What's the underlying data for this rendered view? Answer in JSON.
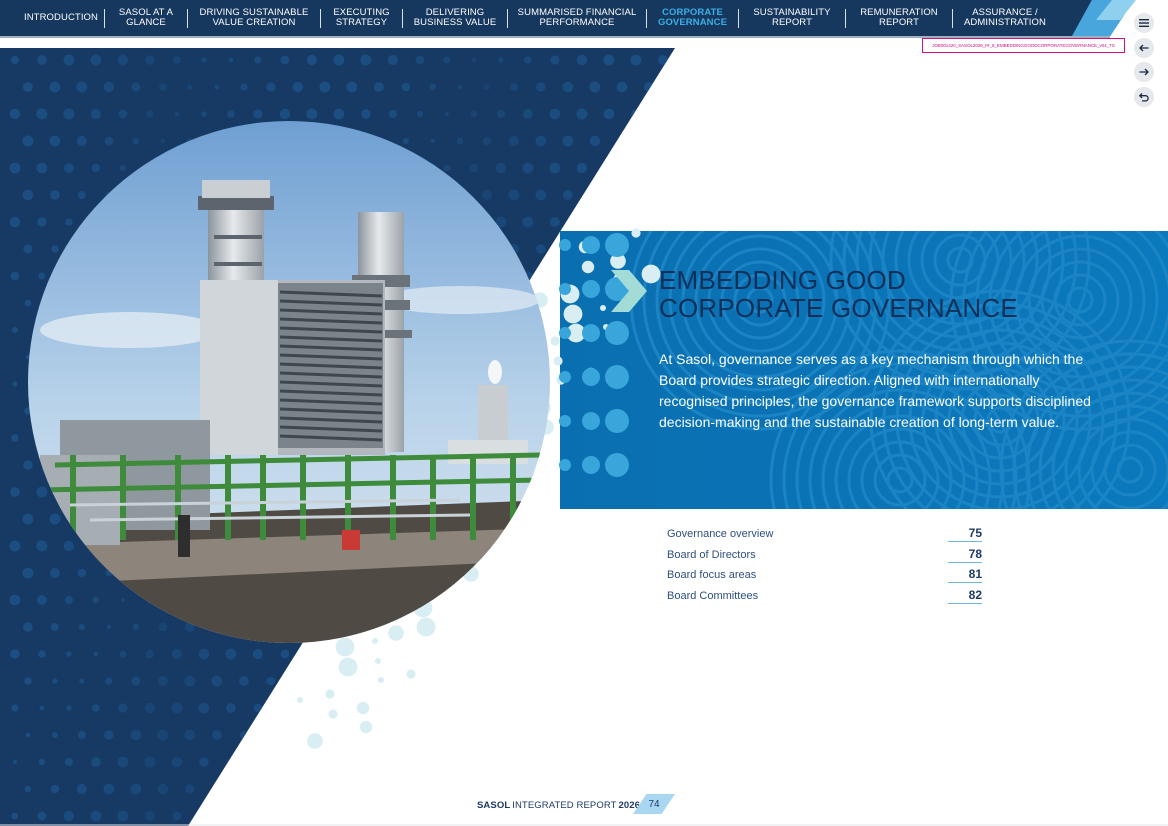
{
  "nav": {
    "items": [
      {
        "line1": "INTRODUCTION",
        "line2": ""
      },
      {
        "line1": "SASOL AT A",
        "line2": "GLANCE"
      },
      {
        "line1": "DRIVING SUSTAINABLE",
        "line2": "VALUE CREATION"
      },
      {
        "line1": "EXECUTING",
        "line2": "STRATEGY"
      },
      {
        "line1": "DELIVERING",
        "line2": "BUSINESS VALUE"
      },
      {
        "line1": "SUMMARISED FINANCIAL",
        "line2": "PERFORMANCE"
      },
      {
        "line1": "CORPORATE",
        "line2": "GOVERNANCE"
      },
      {
        "line1": "SUSTAINABILITY",
        "line2": "REPORT"
      },
      {
        "line1": "REMUNERATION",
        "line2": "REPORT"
      },
      {
        "line1": "ASSURANCE /",
        "line2": "ADMINISTRATION"
      }
    ],
    "active_index": 6
  },
  "controls": {
    "menu_icon": "hamburger-menu-icon",
    "back_icon": "arrow-left-icon",
    "forward_icon": "arrow-right-icon",
    "return_icon": "return-arrow-icon"
  },
  "job_ref": "JOB001420_SASOL2026_IR_8_EMBEDDINGGOODCORPORATEGOVERNANCE_v04_TS",
  "banner": {
    "headline_line1": "EMBEDDING GOOD",
    "headline_line2": "CORPORATE GOVERNANCE",
    "intro": "At Sasol, governance serves as a key mechanism through which the Board provides strategic direction. Aligned with internationally recognised principles, the governance framework supports disciplined decision-making and the sustainable creation of long-term value."
  },
  "toc": [
    {
      "label": "Governance overview",
      "page": "75"
    },
    {
      "label": "Board of Directors",
      "page": "78"
    },
    {
      "label": "Board focus areas",
      "page": "81"
    },
    {
      "label": "Board Committees",
      "page": "82"
    }
  ],
  "footer": {
    "brand": "SASOL",
    "report": "INTEGRATED REPORT",
    "year": "2026",
    "page_number": "74"
  },
  "colors": {
    "navy": "#16375e",
    "banner_blue": "#0a72b4",
    "accent_blue": "#3ab0e6",
    "chevron": "#a3dcd6",
    "toc_text": "#2e4f80",
    "job_ref": "#d0107f"
  }
}
